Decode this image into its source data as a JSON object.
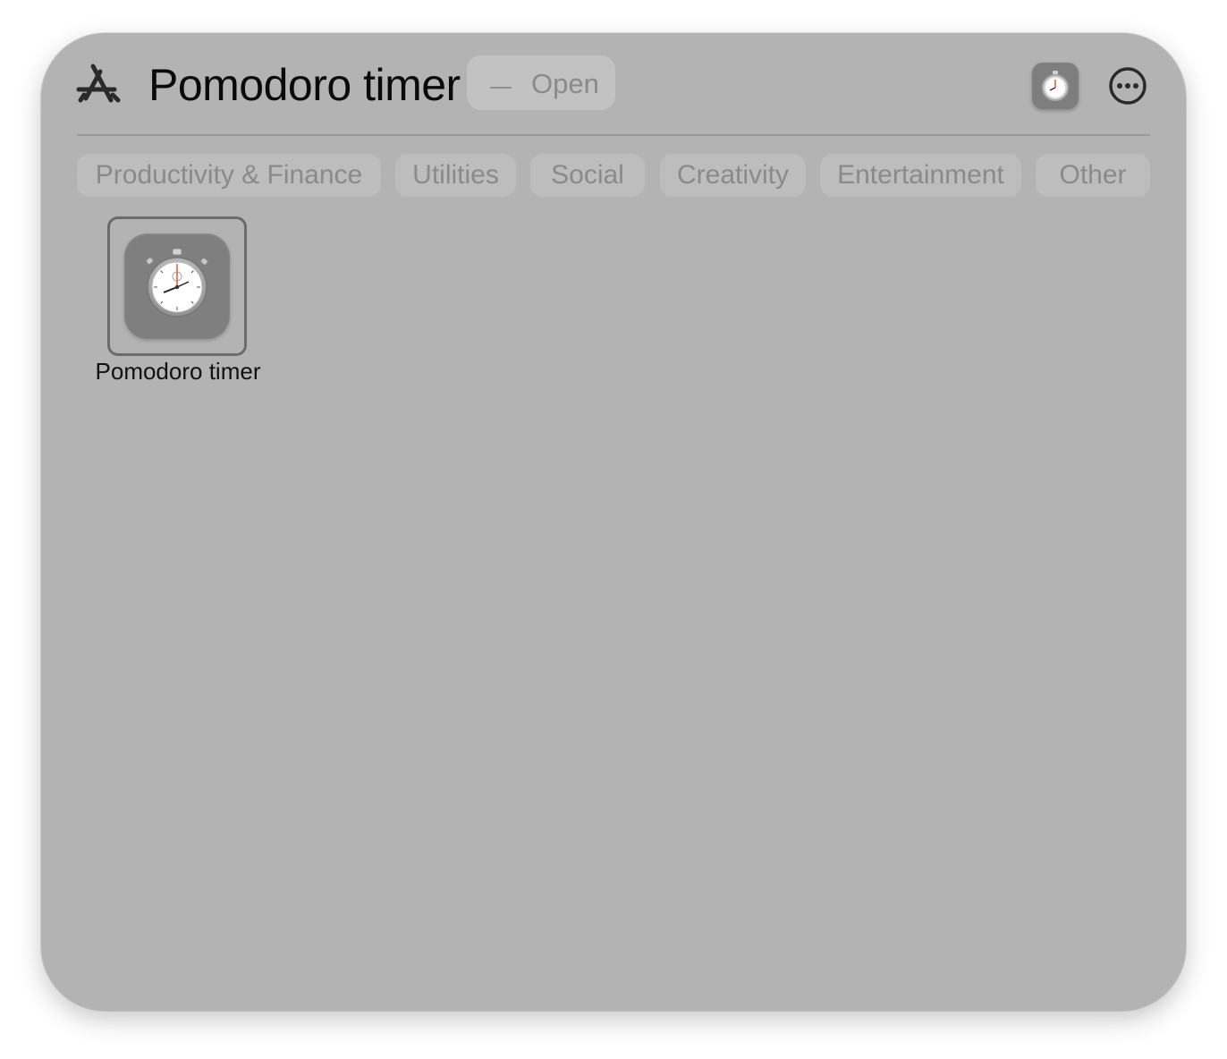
{
  "header": {
    "title": "Pomodoro timer",
    "open_label": "Open",
    "app_store_icon": "app-store-icon",
    "more_icon": "ellipsis-circle-icon",
    "thumb_icon": "stopwatch-icon"
  },
  "tabs": [
    {
      "label": "Productivity & Finance"
    },
    {
      "label": "Utilities"
    },
    {
      "label": "Social"
    },
    {
      "label": "Creativity"
    },
    {
      "label": "Entertainment"
    },
    {
      "label": "Other"
    }
  ],
  "apps": [
    {
      "name": "Pomodoro timer",
      "icon": "stopwatch-icon",
      "selected": true
    }
  ],
  "colors": {
    "window_bg": "#b3b3b3",
    "tab_bg": "#bdbdbd",
    "tab_text": "#8a8a8a",
    "stopwatch_hand": "#e8592a"
  }
}
